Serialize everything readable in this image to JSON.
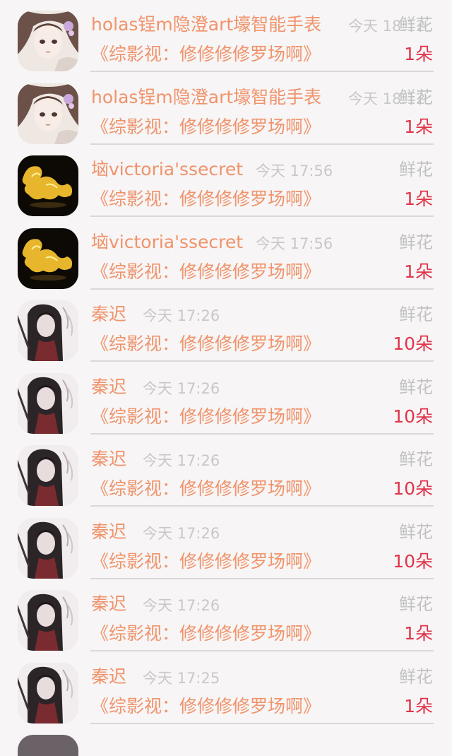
{
  "rows": [
    {
      "avatar": "anime-girl-avatar",
      "name": "holas锃m隐澄art壕智能手表",
      "time": "今天 18:12",
      "gift_type": "鲜花",
      "work": "《综影视：修修修修罗场啊》",
      "count": "1朵"
    },
    {
      "avatar": "anime-girl-avatar",
      "name": "holas锃m隐澄art壕智能手表",
      "time": "今天 18:12",
      "gift_type": "鲜花",
      "work": "《综影视：修修修修罗场啊》",
      "count": "1朵"
    },
    {
      "avatar": "golden-dragon-avatar",
      "name": "垴victoria'ssecret",
      "time": "今天 17:56",
      "gift_type": "鲜花",
      "work": "《综影视：修修修修罗场啊》",
      "count": "1朵"
    },
    {
      "avatar": "golden-dragon-avatar",
      "name": "垴victoria'ssecret",
      "time": "今天 17:56",
      "gift_type": "鲜花",
      "work": "《综影视：修修修修罗场啊》",
      "count": "1朵"
    },
    {
      "avatar": "dark-hair-man-avatar",
      "name": "秦迟",
      "time": "今天 17:26",
      "gift_type": "鲜花",
      "work": "《综影视：修修修修罗场啊》",
      "count": "10朵"
    },
    {
      "avatar": "dark-hair-man-avatar",
      "name": "秦迟",
      "time": "今天 17:26",
      "gift_type": "鲜花",
      "work": "《综影视：修修修修罗场啊》",
      "count": "10朵"
    },
    {
      "avatar": "dark-hair-man-avatar",
      "name": "秦迟",
      "time": "今天 17:26",
      "gift_type": "鲜花",
      "work": "《综影视：修修修修罗场啊》",
      "count": "10朵"
    },
    {
      "avatar": "dark-hair-man-avatar",
      "name": "秦迟",
      "time": "今天 17:26",
      "gift_type": "鲜花",
      "work": "《综影视：修修修修罗场啊》",
      "count": "10朵"
    },
    {
      "avatar": "dark-hair-man-avatar",
      "name": "秦迟",
      "time": "今天 17:26",
      "gift_type": "鲜花",
      "work": "《综影视：修修修修罗场啊》",
      "count": "1朵"
    },
    {
      "avatar": "dark-hair-man-avatar",
      "name": "秦迟",
      "time": "今天 17:25",
      "gift_type": "鲜花",
      "work": "《综影视：修修修修罗场啊》",
      "count": "1朵"
    }
  ],
  "colors": {
    "name": "#f0936a",
    "time": "#c8c8c8",
    "gift_type": "#c2c2c2",
    "count": "#e0344a",
    "divider": "#d9d9d9",
    "background": "#f7f5f6"
  }
}
